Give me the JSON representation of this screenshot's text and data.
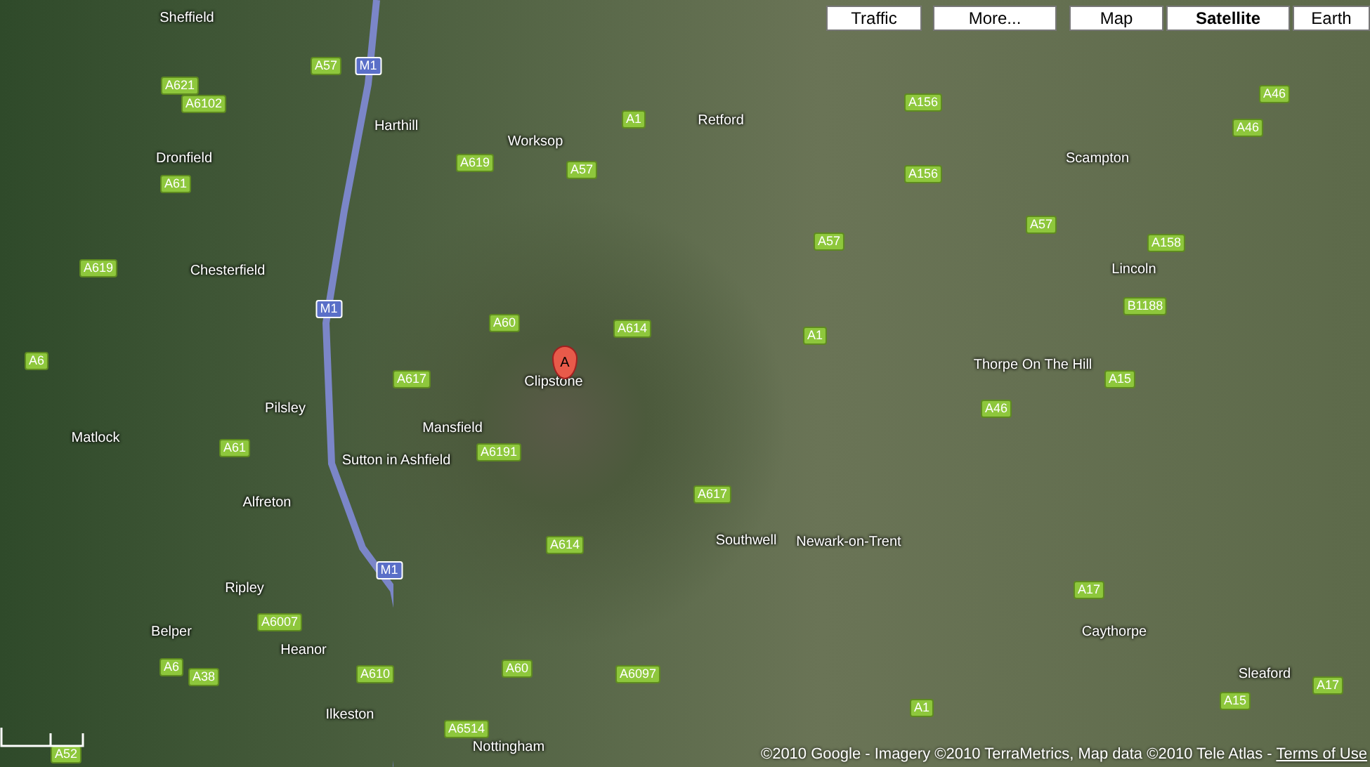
{
  "controls": [
    {
      "label": "Traffic"
    },
    {
      "label": "More..."
    }
  ],
  "map_types": [
    {
      "label": "Map",
      "selected": false
    },
    {
      "label": "Satellite",
      "selected": true
    },
    {
      "label": "Earth",
      "selected": false
    }
  ],
  "marker": {
    "label": "A"
  },
  "places": [
    "Sheffield",
    "Harthill",
    "Worksop",
    "Retford",
    "Scampton",
    "Dronfield",
    "Chesterfield",
    "Lincoln",
    "Thorpe On The Hill",
    "Clipstone",
    "Mansfield",
    "Pilsley",
    "Matlock",
    "Sutton in Ashfield",
    "Alfreton",
    "Southwell",
    "Newark-on-Trent",
    "Ripley",
    "Belper",
    "Heanor",
    "Caythorpe",
    "Sleaford",
    "Ilkeston",
    "Nottingham"
  ],
  "roads": [
    {
      "label": "A621",
      "kind": "a"
    },
    {
      "label": "A57",
      "kind": "a"
    },
    {
      "label": "M1",
      "kind": "m"
    },
    {
      "label": "A6102",
      "kind": "a"
    },
    {
      "label": "A1",
      "kind": "a"
    },
    {
      "label": "A156",
      "kind": "a"
    },
    {
      "label": "A46",
      "kind": "a"
    },
    {
      "label": "A46",
      "kind": "a"
    },
    {
      "label": "A61",
      "kind": "a"
    },
    {
      "label": "A619",
      "kind": "a"
    },
    {
      "label": "A57",
      "kind": "a"
    },
    {
      "label": "A156",
      "kind": "a"
    },
    {
      "label": "A619",
      "kind": "a"
    },
    {
      "label": "A57",
      "kind": "a"
    },
    {
      "label": "A57",
      "kind": "a"
    },
    {
      "label": "A158",
      "kind": "a"
    },
    {
      "label": "M1",
      "kind": "m"
    },
    {
      "label": "A60",
      "kind": "a"
    },
    {
      "label": "A614",
      "kind": "a"
    },
    {
      "label": "A1",
      "kind": "a"
    },
    {
      "label": "B1188",
      "kind": "a"
    },
    {
      "label": "A6",
      "kind": "a"
    },
    {
      "label": "A617",
      "kind": "a"
    },
    {
      "label": "A46",
      "kind": "a"
    },
    {
      "label": "A15",
      "kind": "a"
    },
    {
      "label": "A61",
      "kind": "a"
    },
    {
      "label": "A6191",
      "kind": "a"
    },
    {
      "label": "A617",
      "kind": "a"
    },
    {
      "label": "A614",
      "kind": "a"
    },
    {
      "label": "M1",
      "kind": "m"
    },
    {
      "label": "A17",
      "kind": "a"
    },
    {
      "label": "A6007",
      "kind": "a"
    },
    {
      "label": "A6",
      "kind": "a"
    },
    {
      "label": "A38",
      "kind": "a"
    },
    {
      "label": "A610",
      "kind": "a"
    },
    {
      "label": "A60",
      "kind": "a"
    },
    {
      "label": "A6097",
      "kind": "a"
    },
    {
      "label": "A1",
      "kind": "a"
    },
    {
      "label": "A15",
      "kind": "a"
    },
    {
      "label": "A17",
      "kind": "a"
    },
    {
      "label": "A6514",
      "kind": "a"
    },
    {
      "label": "A52",
      "kind": "a"
    }
  ],
  "copyright": "©2010 Google - Imagery ©2010 TerraMetrics, Map data ©2010 Tele Atlas - ",
  "terms_link": "Terms of Use"
}
